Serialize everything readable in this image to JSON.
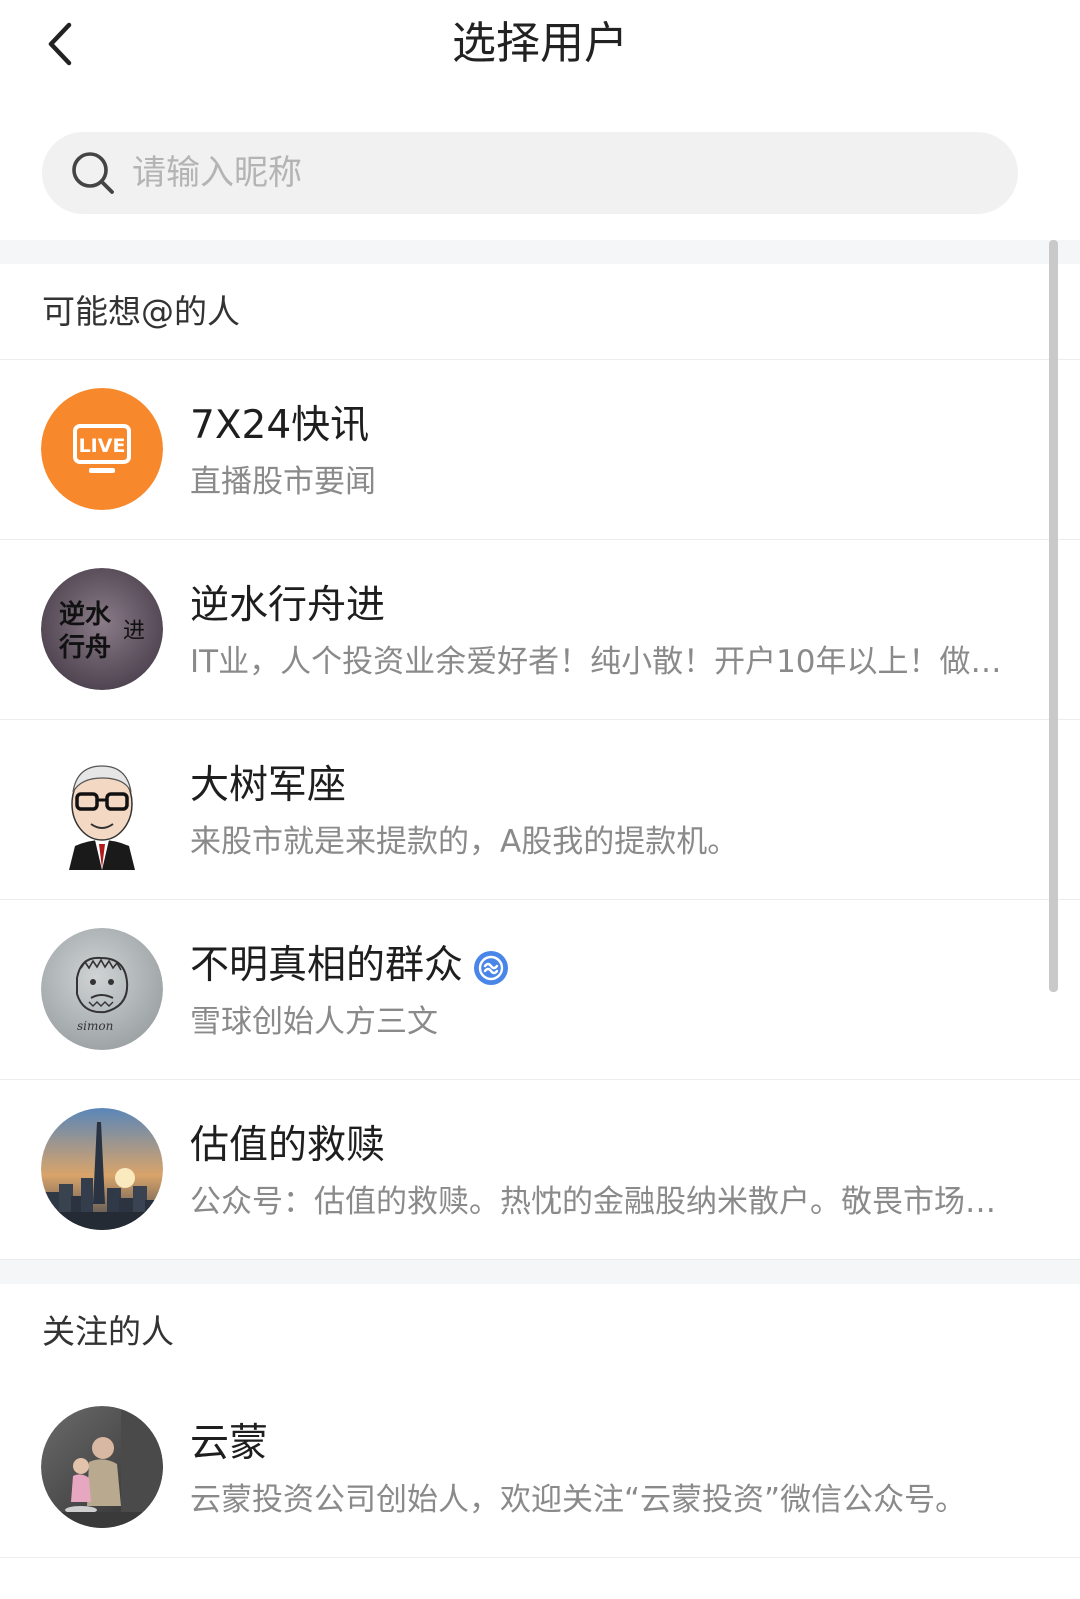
{
  "header": {
    "title": "选择用户"
  },
  "search": {
    "placeholder": "请输入昵称",
    "value": ""
  },
  "sections": [
    {
      "title": "可能想@的人"
    },
    {
      "title": "关注的人"
    }
  ],
  "users": [
    {
      "name": "7X24快讯",
      "desc": "直播股市要闻",
      "avatar_text": "LIVE",
      "avatar_color": "#f7882b"
    },
    {
      "name": "逆水行舟进",
      "desc": "IT业，人个投资业余爱好者！纯小散！开户10年以上！做过不少亏本生意",
      "avatar_text_1": "逆水",
      "avatar_text_2": "行舟",
      "avatar_text_3": "进",
      "avatar_color": "#5d5060"
    },
    {
      "name": "大树军座",
      "desc": "来股市就是来提款的，A股我的提款机。"
    },
    {
      "name": "不明真相的群众",
      "desc": "雪球创始人方三文",
      "verified": true,
      "avatar_sign": "simon"
    },
    {
      "name": "估值的救赎",
      "desc": "公众号：估值的救赎。热忱的金融股纳米散户。敬畏市场，理性投资"
    },
    {
      "name": "云蒙",
      "desc": "云蒙投资公司创始人，欢迎关注“云蒙投资”微信公众号。"
    }
  ],
  "colors": {
    "accent_blue": "#4a86e8",
    "live_orange": "#f7882b"
  }
}
